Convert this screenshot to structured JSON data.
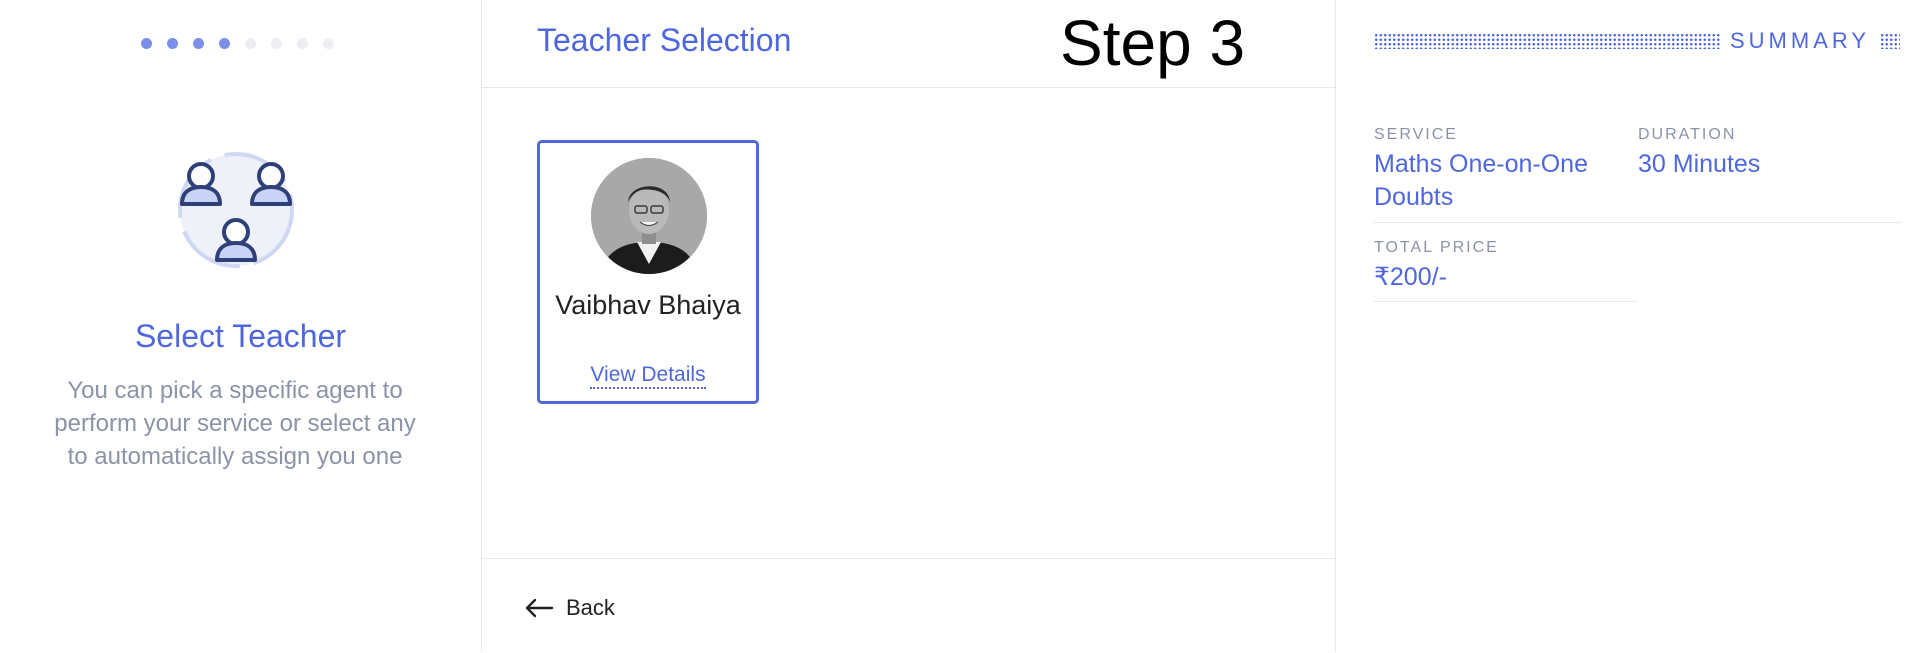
{
  "progress": {
    "total_steps": 8,
    "completed_steps": 4
  },
  "left_panel": {
    "icon": "group-users-icon",
    "title": "Select Teacher",
    "description": "You can pick a specific agent to perform your service or select any to automatically assign you one"
  },
  "main": {
    "title": "Teacher Selection",
    "step_label": "Step 3",
    "teachers": [
      {
        "name": "Vaibhav Bhaiya",
        "link_label": "View Details",
        "selected": true
      }
    ],
    "back_label": "Back"
  },
  "summary": {
    "title": "SUMMARY",
    "service_label": "SERVICE",
    "service_value": "Maths One-on-One Doubts",
    "duration_label": "DURATION",
    "duration_value": "30 Minutes",
    "price_label": "TOTAL PRICE",
    "price_value": "₹200/-"
  },
  "colors": {
    "accent": "#4f67dc",
    "muted_text": "#8c93a6",
    "divider": "#e6e8ee",
    "progress_active": "#7b8fe8",
    "progress_inactive": "#eceef2"
  }
}
